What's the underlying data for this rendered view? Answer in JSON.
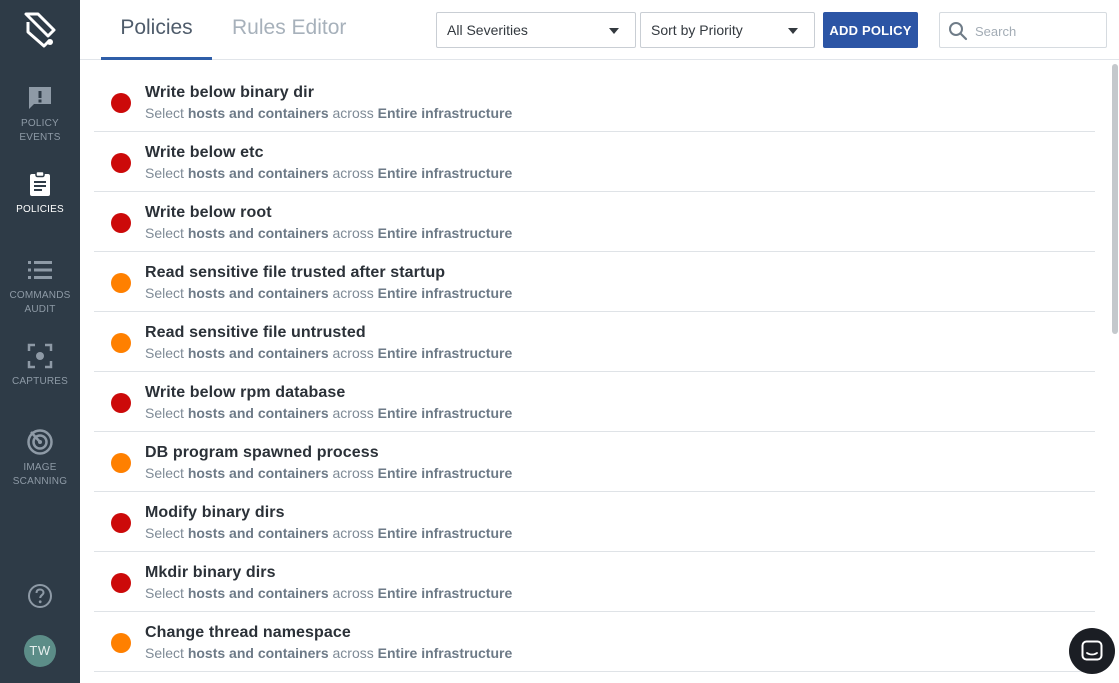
{
  "sidebar": {
    "items": [
      {
        "label": "POLICY EVENTS",
        "icon": "policy-events-icon",
        "active": false
      },
      {
        "label": "POLICIES",
        "icon": "clipboard-icon",
        "active": true
      },
      {
        "label": "COMMANDS AUDIT",
        "icon": "list-icon",
        "active": false
      },
      {
        "label": "CAPTURES",
        "icon": "capture-icon",
        "active": false
      },
      {
        "label": "IMAGE SCANNING",
        "icon": "radar-icon",
        "active": false
      }
    ],
    "avatar_initials": "TW"
  },
  "header": {
    "tabs": [
      {
        "label": "Policies",
        "active": true
      },
      {
        "label": "Rules Editor",
        "active": false
      }
    ],
    "severity_filter": "All Severities",
    "sort_select": "Sort by Priority",
    "add_policy_label": "ADD POLICY",
    "search_placeholder": "Search"
  },
  "policies": [
    {
      "name": "Write below binary dir",
      "severity": "high",
      "select_word": "Select",
      "scope": "hosts and containers",
      "across_word": "across",
      "target": "Entire infrastructure"
    },
    {
      "name": "Write below etc",
      "severity": "high",
      "select_word": "Select",
      "scope": "hosts and containers",
      "across_word": "across",
      "target": "Entire infrastructure"
    },
    {
      "name": "Write below root",
      "severity": "high",
      "select_word": "Select",
      "scope": "hosts and containers",
      "across_word": "across",
      "target": "Entire infrastructure"
    },
    {
      "name": "Read sensitive file trusted after startup",
      "severity": "medium",
      "select_word": "Select",
      "scope": "hosts and containers",
      "across_word": "across",
      "target": "Entire infrastructure"
    },
    {
      "name": "Read sensitive file untrusted",
      "severity": "medium",
      "select_word": "Select",
      "scope": "hosts and containers",
      "across_word": "across",
      "target": "Entire infrastructure"
    },
    {
      "name": "Write below rpm database",
      "severity": "high",
      "select_word": "Select",
      "scope": "hosts and containers",
      "across_word": "across",
      "target": "Entire infrastructure"
    },
    {
      "name": "DB program spawned process",
      "severity": "medium",
      "select_word": "Select",
      "scope": "hosts and containers",
      "across_word": "across",
      "target": "Entire infrastructure"
    },
    {
      "name": "Modify binary dirs",
      "severity": "high",
      "select_word": "Select",
      "scope": "hosts and containers",
      "across_word": "across",
      "target": "Entire infrastructure"
    },
    {
      "name": "Mkdir binary dirs",
      "severity": "high",
      "select_word": "Select",
      "scope": "hosts and containers",
      "across_word": "across",
      "target": "Entire infrastructure"
    },
    {
      "name": "Change thread namespace",
      "severity": "medium",
      "select_word": "Select",
      "scope": "hosts and containers",
      "across_word": "across",
      "target": "Entire infrastructure"
    }
  ],
  "colors": {
    "sidebar_bg": "#2e3b47",
    "accent": "#2c55a5",
    "severity_high": "#cc0a0a",
    "severity_medium": "#ff8000"
  }
}
